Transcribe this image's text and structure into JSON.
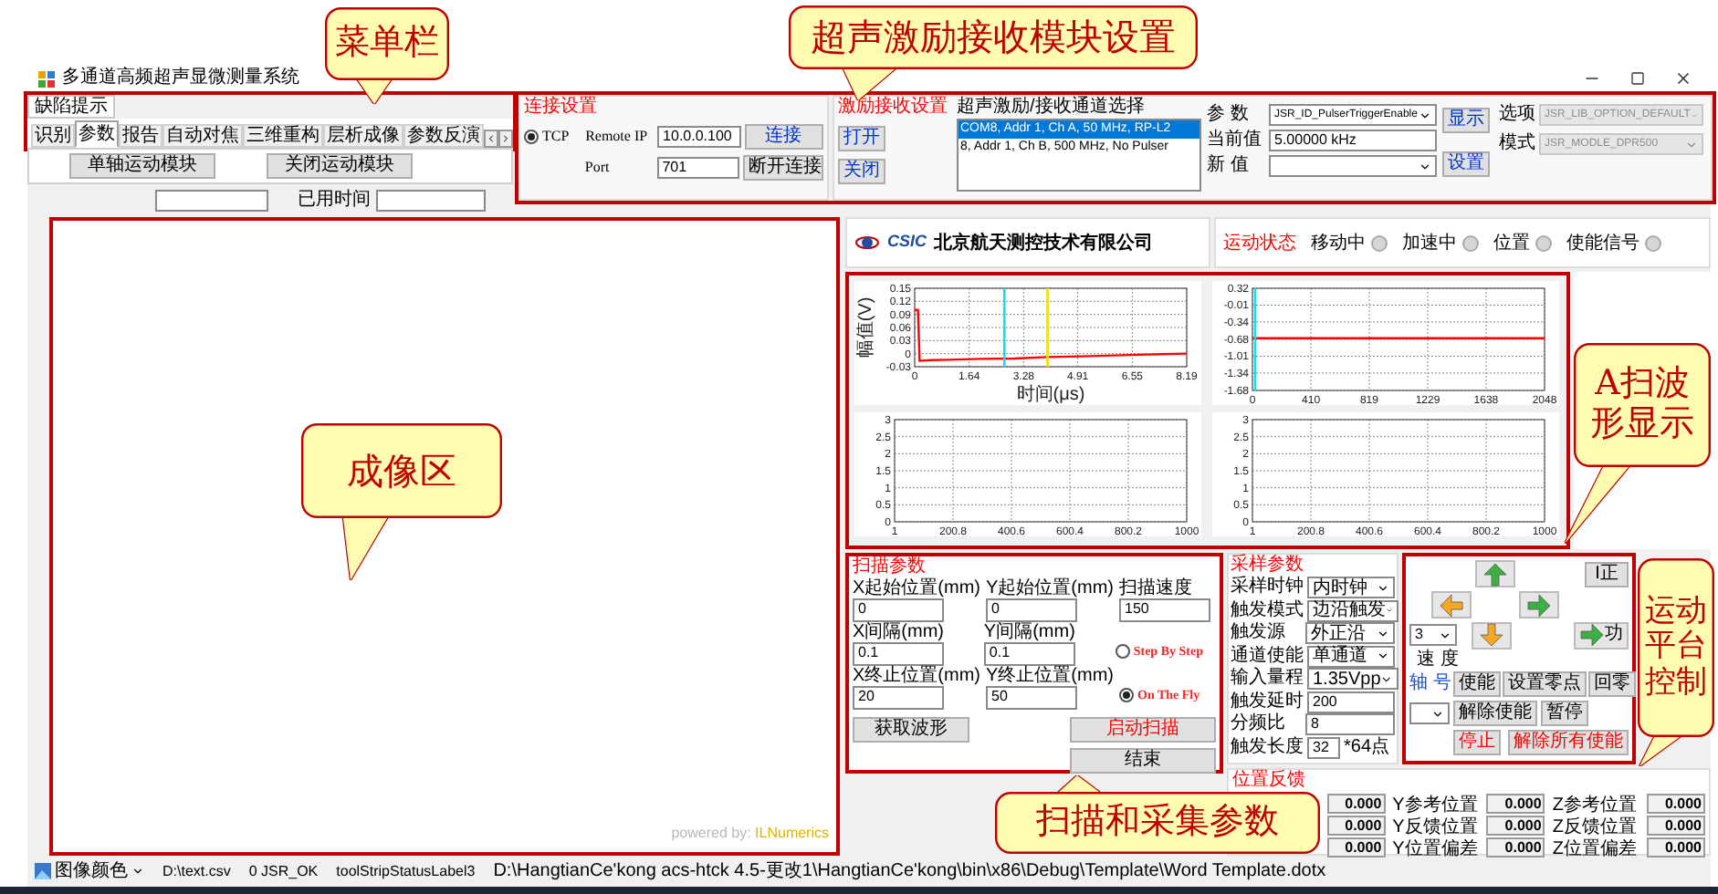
{
  "window": {
    "title": "多通道高频超声显微测量系统"
  },
  "top_panel": {
    "header": "缺陷提示",
    "tabs": [
      {
        "label": "识别",
        "selected": false
      },
      {
        "label": "参数",
        "selected": true
      },
      {
        "label": "报告",
        "selected": false
      },
      {
        "label": "自动对焦",
        "selected": false
      },
      {
        "label": "三维重构",
        "selected": false
      },
      {
        "label": "层析成像",
        "selected": false
      },
      {
        "label": "参数反演",
        "selected": false
      }
    ],
    "buttons": [
      "单轴运动模块",
      "关闭运动模块"
    ],
    "elapsed_label": "已用时间"
  },
  "connection": {
    "title": "连接设置",
    "protocol": {
      "label": "TCP",
      "selected": true
    },
    "remote_ip_label": "Remote IP",
    "remote_ip": "10.0.0.100",
    "port_label": "Port",
    "port": "701",
    "buttons": [
      "连接",
      "断开连接"
    ]
  },
  "pulser": {
    "title": "激励接收设置",
    "buttons": [
      "打开",
      "关闭"
    ],
    "channel_list_title": "超声激励/接收通道选择",
    "channels": [
      {
        "label": "COM8, Addr 1, Ch A, 50 MHz, RP-L2",
        "selected": true
      },
      {
        "label": "8, Addr 1, Ch B, 500 MHz, No Pulser",
        "selected": false
      }
    ],
    "params": [
      {
        "label": "参 数",
        "value": "JSR_ID_PulserTriggerEnable",
        "kind": "dropdown"
      },
      {
        "label": "当前值",
        "value": "5.00000 kHz",
        "kind": "readonly"
      },
      {
        "label": "新 值",
        "kind": "dropdown"
      }
    ],
    "action_buttons": [
      "显示",
      "设置"
    ],
    "options": [
      {
        "label": "选项",
        "value": "JSR_LIB_OPTION_DEFAULT",
        "disabled": true
      },
      {
        "label": "模式",
        "value": "JSR_MODLE_DPR500",
        "disabled": true
      }
    ]
  },
  "company": {
    "logo_text": "CSIC",
    "name": "北京航天测控技术有限公司"
  },
  "motion_status": {
    "title": "运动状态",
    "indicators": [
      {
        "label": "移动中",
        "on": false
      },
      {
        "label": "加速中",
        "on": false
      },
      {
        "label": "位置",
        "on": false
      },
      {
        "label": "使能信号",
        "on": false
      }
    ]
  },
  "imaging": {
    "credit_prefix": "powered by:",
    "credit_name": "ILNumerics"
  },
  "charts": [
    {
      "chart_data": {
        "type": "line",
        "xlabel": "时间(μs)",
        "ylabel": "幅值(V)",
        "x": [
          0,
          0.1,
          0.15,
          0.5,
          1,
          2,
          3,
          4,
          5,
          6,
          7,
          8.19
        ],
        "series": [
          {
            "color": "#ff0000",
            "values": [
              0.1,
              0.1,
              -0.016,
              -0.015,
              -0.014,
              -0.012,
              -0.011,
              -0.008,
              -0.006,
              -0.004,
              -0.002,
              0.0
            ]
          }
        ],
        "xlim": [
          0,
          8.19
        ],
        "ylim": [
          -0.03,
          0.15
        ],
        "xticks": [
          0,
          1.64,
          3.28,
          4.91,
          6.55,
          8.19
        ],
        "yticks": [
          -0.03,
          0,
          0.03,
          0.06,
          0.09,
          0.12,
          0.15
        ],
        "grid": true,
        "ref_lines": [
          {
            "axis": "x",
            "value": 2.7,
            "color": "#00e5ee"
          },
          {
            "axis": "x",
            "value": 4.0,
            "color": "#f0e000"
          }
        ]
      }
    },
    {
      "chart_data": {
        "type": "line",
        "x": [
          0,
          2048
        ],
        "series": [
          {
            "color": "#ff0000",
            "values": [
              -0.66,
              -0.66
            ]
          }
        ],
        "xlim": [
          0,
          2048
        ],
        "ylim": [
          -1.68,
          0.32
        ],
        "xticks": [
          0,
          410,
          819,
          1229,
          1638,
          2048
        ],
        "yticks": [
          -1.68,
          -1.34,
          -1.01,
          -0.68,
          -0.34,
          -0.01,
          0.32
        ],
        "grid": true
      }
    },
    {
      "chart_data": {
        "type": "line",
        "xlim": [
          1,
          1000
        ],
        "ylim": [
          0,
          3
        ],
        "xticks": [
          1,
          200.8,
          400.6,
          600.4,
          800.2,
          1000
        ],
        "yticks": [
          0,
          0.5,
          1,
          1.5,
          2,
          2.5,
          3
        ],
        "grid": true
      }
    },
    {
      "chart_data": {
        "type": "line",
        "xlim": [
          1,
          1000
        ],
        "ylim": [
          0,
          3
        ],
        "xticks": [
          1,
          200.8,
          400.6,
          600.4,
          800.2,
          1000
        ],
        "yticks": [
          0,
          0.5,
          1,
          1.5,
          2,
          2.5,
          3
        ],
        "grid": true
      }
    }
  ],
  "scan": {
    "title": "扫描参数",
    "fields": [
      {
        "label": "X起始位置(mm)",
        "value": "0"
      },
      {
        "label": "Y起始位置(mm)",
        "value": "0"
      },
      {
        "label": "扫描速度",
        "value": "150"
      },
      {
        "label": "X间隔(mm)",
        "value": "0.1"
      },
      {
        "label": "Y间隔(mm)",
        "value": "0.1"
      },
      {
        "label": "X终止位置(mm)",
        "value": "20"
      },
      {
        "label": "Y终止位置(mm)",
        "value": "50"
      }
    ],
    "modes": [
      {
        "label": "Step By Step",
        "selected": false
      },
      {
        "label": "On The Fly",
        "selected": true
      }
    ],
    "buttons": [
      "获取波形",
      "启动扫描",
      "结束"
    ]
  },
  "sampling": {
    "title": "采样参数",
    "rows": [
      {
        "label": "采样时钟",
        "value": "内时钟",
        "kind": "dropdown"
      },
      {
        "label": "触发模式",
        "value": "边沿触发",
        "kind": "dropdown"
      },
      {
        "label": "触发源",
        "value": "外正沿",
        "kind": "dropdown"
      },
      {
        "label": "通道使能",
        "value": "单通道",
        "kind": "dropdown"
      },
      {
        "label": "输入量程",
        "value": "1.35Vpp",
        "kind": "dropdown"
      },
      {
        "label": "触发延时",
        "value": "200",
        "kind": "input"
      },
      {
        "label": "分频比",
        "value": "8",
        "kind": "input"
      },
      {
        "label": "触发长度",
        "value": "32",
        "kind": "input",
        "unit": "*64点"
      }
    ]
  },
  "motion": {
    "home_button": "I正",
    "speed": "3",
    "speed_label": "速 度",
    "jog_button": "功",
    "axis_label": "轴 号",
    "buttons": [
      {
        "label": "使能",
        "danger": false
      },
      {
        "label": "设置零点",
        "danger": false
      },
      {
        "label": "回零",
        "danger": false
      },
      {
        "label": "解除使能",
        "danger": false
      },
      {
        "label": "暂停",
        "danger": false
      },
      {
        "label": "停止",
        "danger": true
      },
      {
        "label": "解除所有使能",
        "danger": true
      }
    ]
  },
  "position_feedback": {
    "title": "位置反馈",
    "items": [
      {
        "value": "0.000"
      },
      {
        "value": "0.000"
      },
      {
        "value": "0.000"
      },
      {
        "label": "Y参考位置",
        "value": "0.000"
      },
      {
        "label": "Y反馈位置",
        "value": "0.000"
      },
      {
        "label": "Y位置偏差",
        "value": "0.000"
      },
      {
        "label": "Z参考位置",
        "value": "0.000"
      },
      {
        "label": "Z反馈位置",
        "value": "0.000"
      },
      {
        "label": "Z位置偏差",
        "value": "0.000"
      }
    ]
  },
  "status_bar": {
    "color_button": "图像颜色",
    "items": [
      "D:\\text.csv",
      "0 JSR_OK",
      "toolStripStatusLabel3",
      "D:\\HangtianCe'kong acs-htck 4.5-更改1\\HangtianCe'kong\\bin\\x86\\Debug\\Template\\Word Template.dotx"
    ]
  },
  "callouts": [
    {
      "text": "菜单栏"
    },
    {
      "text": "超声激励接收模块设置"
    },
    {
      "text": "A扫波形显示"
    },
    {
      "text": "成像区"
    },
    {
      "text": "扫描和采集参数"
    },
    {
      "text": "运动平台控制"
    }
  ]
}
